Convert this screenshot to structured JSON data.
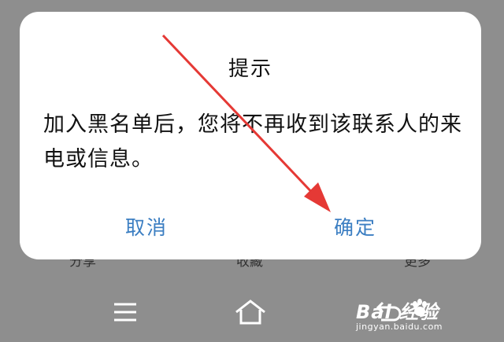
{
  "dialog": {
    "title": "提示",
    "message": "加入黑名单后，您将不再收到该联系人的来电或信息。",
    "cancel_label": "取消",
    "confirm_label": "确定"
  },
  "bottom_actions": {
    "share_label": "分享",
    "favorite_label": "收藏",
    "more_label": "更多"
  },
  "nav_bar": {
    "menu_icon": "menu-icon",
    "home_icon": "home-icon",
    "back_icon": "back-icon"
  },
  "watermark": {
    "brand_text": "Bai 经验",
    "url_text": "jingyan.baidu.com"
  },
  "colors": {
    "accent": "#3b7ec2",
    "annotation_arrow": "#e53935",
    "overlay_background": "#8e8e8e"
  }
}
